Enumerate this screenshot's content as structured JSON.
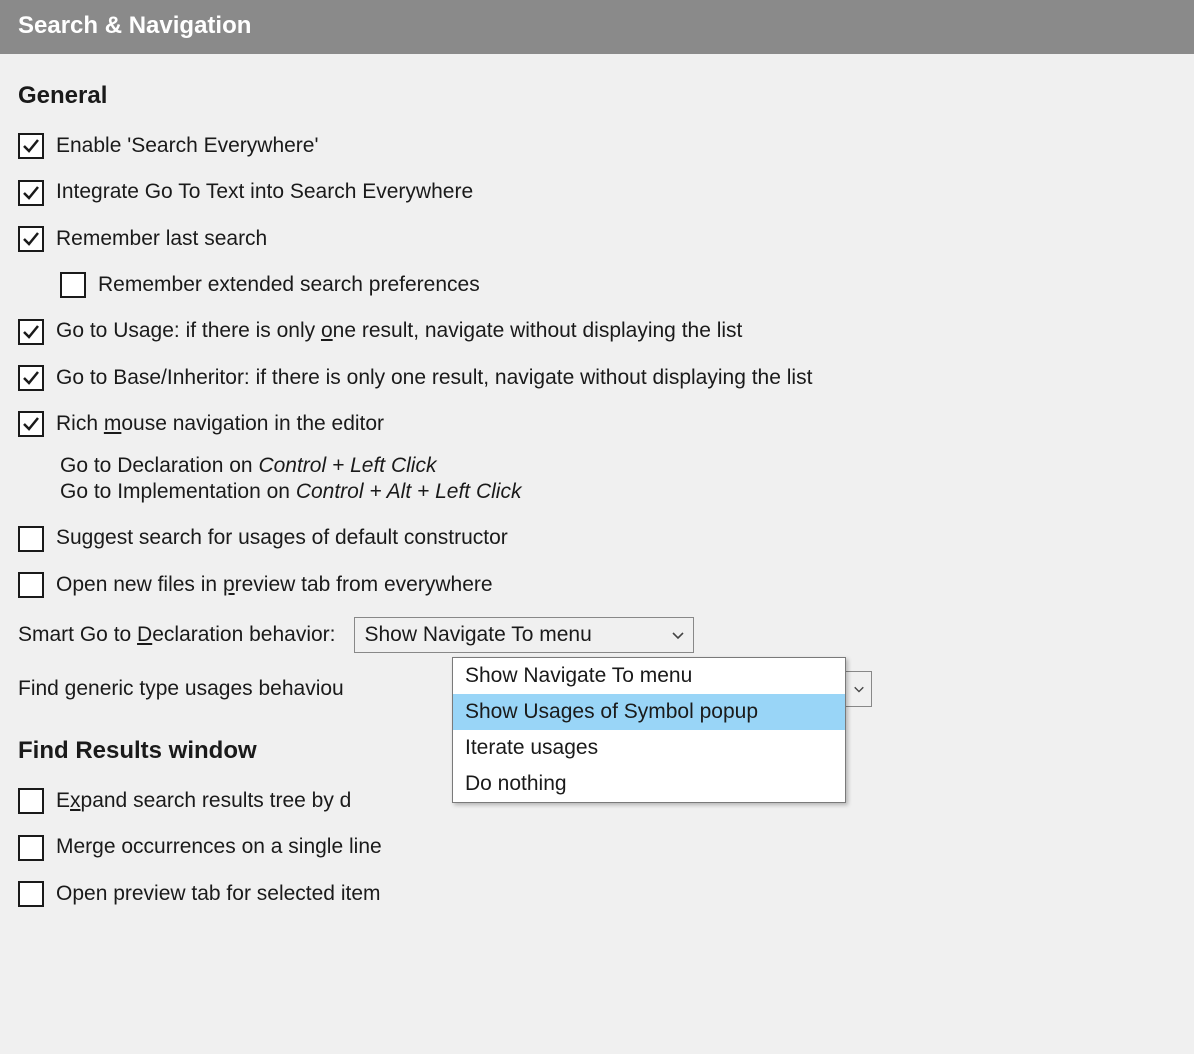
{
  "header": {
    "title": "Search & Navigation"
  },
  "general": {
    "title": "General",
    "enable_search_everywhere": "Enable 'Search Everywhere'",
    "integrate_goto_text": "Integrate Go To Text into Search Everywhere",
    "remember_last_search": "Remember last search",
    "remember_extended": "Remember extended search preferences",
    "goto_usage_pre": "Go to Usage: if there is only ",
    "goto_usage_u": "o",
    "goto_usage_post": "ne result, navigate without displaying the list",
    "goto_base": "Go to Base/Inheritor: if there is only one result, navigate without displaying the list",
    "rich_mouse_pre": "Rich ",
    "rich_mouse_u": "m",
    "rich_mouse_post": "ouse navigation in the editor",
    "goto_decl_prefix": "Go to Declaration on ",
    "goto_decl_combo": "Control + Left Click",
    "goto_impl_prefix": "Go to Implementation on ",
    "goto_impl_combo": "Control + Alt + Left Click",
    "suggest_default_ctor": "Suggest search for usages of default constructor",
    "open_new_files_pre": "Open new files in ",
    "open_new_files_u": "p",
    "open_new_files_post": "review tab from everywhere",
    "smart_goto_pre": "Smart Go to ",
    "smart_goto_u": "D",
    "smart_goto_post": "eclaration behavior:",
    "smart_goto_value": "Show Navigate To menu",
    "smart_goto_options": [
      "Show Navigate To menu",
      "Show Usages of Symbol popup",
      "Iterate usages",
      "Do nothing"
    ],
    "find_generic_label": "Find generic type usages behaviou"
  },
  "find_results": {
    "title": "Find Results window",
    "expand_pre": "E",
    "expand_u": "x",
    "expand_post": "pand search results tree by d",
    "merge": "Merge occurrences on a single line",
    "open_preview": "Open preview tab for selected item"
  }
}
